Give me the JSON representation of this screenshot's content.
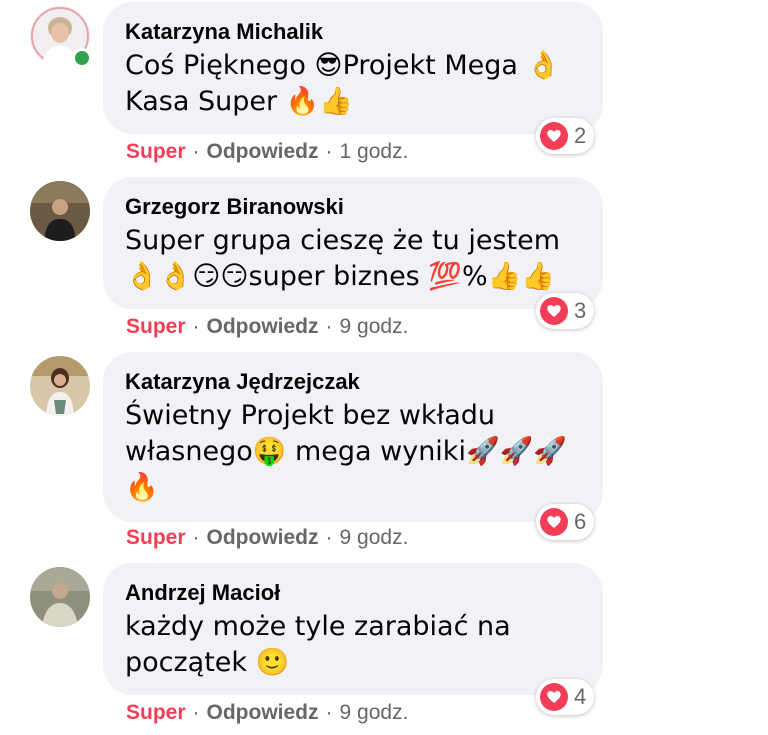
{
  "comments": [
    {
      "author": "Katarzyna Michalik",
      "text_lines": [
        "Coś Pięknego 😎Projekt Mega 👌",
        "Kasa Super 🔥👍"
      ],
      "reaction_count": "2",
      "reaction_label": "Super",
      "reply_label": "Odpowiedz",
      "time": "1 godz.",
      "online": true
    },
    {
      "author": "Grzegorz Biranowski",
      "text_lines": [
        "Super grupa cieszę że tu jestem",
        "👌👌😏😏super biznes 💯%👍👍"
      ],
      "reaction_count": "3",
      "reaction_label": "Super",
      "reply_label": "Odpowiedz",
      "time": "9 godz.",
      "online": false
    },
    {
      "author": "Katarzyna Jędrzejczak",
      "text_lines": [
        "Świetny Projekt bez wkładu",
        "własnego🤑 mega wyniki🚀🚀🚀",
        "🔥"
      ],
      "reaction_count": "6",
      "reaction_label": "Super",
      "reply_label": "Odpowiedz",
      "time": "9 godz.",
      "online": false
    },
    {
      "author": "Andrzej Macioł",
      "text_lines": [
        "każdy może tyle zarabiać na",
        "początek 🙂"
      ],
      "reaction_count": "4",
      "reaction_label": "Super",
      "reply_label": "Odpowiedz",
      "time": "9 godz.",
      "online": false
    }
  ],
  "separator": "·",
  "colors": {
    "bubble": "#f0f2f5",
    "accent_reaction": "#f33e58",
    "secondary_text": "#65676b",
    "online": "#31a24c"
  },
  "icons": {
    "reaction": "heart-icon"
  }
}
